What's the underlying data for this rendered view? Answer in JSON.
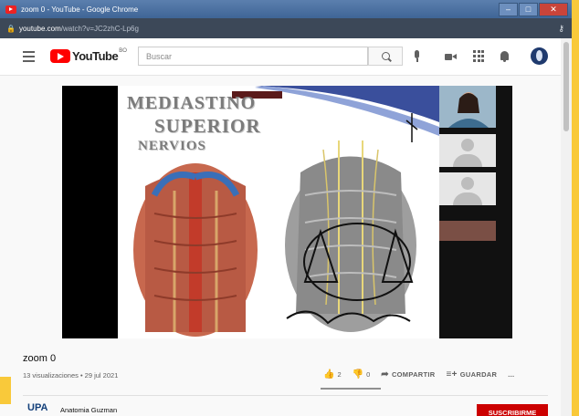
{
  "window": {
    "title": "zoom 0 - YouTube - Google Chrome"
  },
  "address": {
    "domain": "youtube.com",
    "path": "/watch?v=JC2zhC-Lp6g"
  },
  "masthead": {
    "logo_text": "YouTube",
    "logo_country": "BO",
    "search_placeholder": "Buscar"
  },
  "slide": {
    "title_line1": "MEDIASTINO",
    "title_line2": "SUPERIOR",
    "title_line3": "NERVIOS"
  },
  "video": {
    "title": "zoom 0",
    "views_date": "13 visualizaciones • 29 jul 2021",
    "likes": "2",
    "dislikes": "0",
    "share_label": "COMPARTIR",
    "save_label": "GUARDAR",
    "more_label": "..."
  },
  "channel": {
    "logo_text": "UPA",
    "name": "Anatomia Guzman",
    "subscribe_label": "SUSCRIBIRME"
  },
  "colors": {
    "youtube_red": "#ff0000",
    "subscribe_red": "#cc0000",
    "titlebar_blue": "#4a70a2"
  }
}
